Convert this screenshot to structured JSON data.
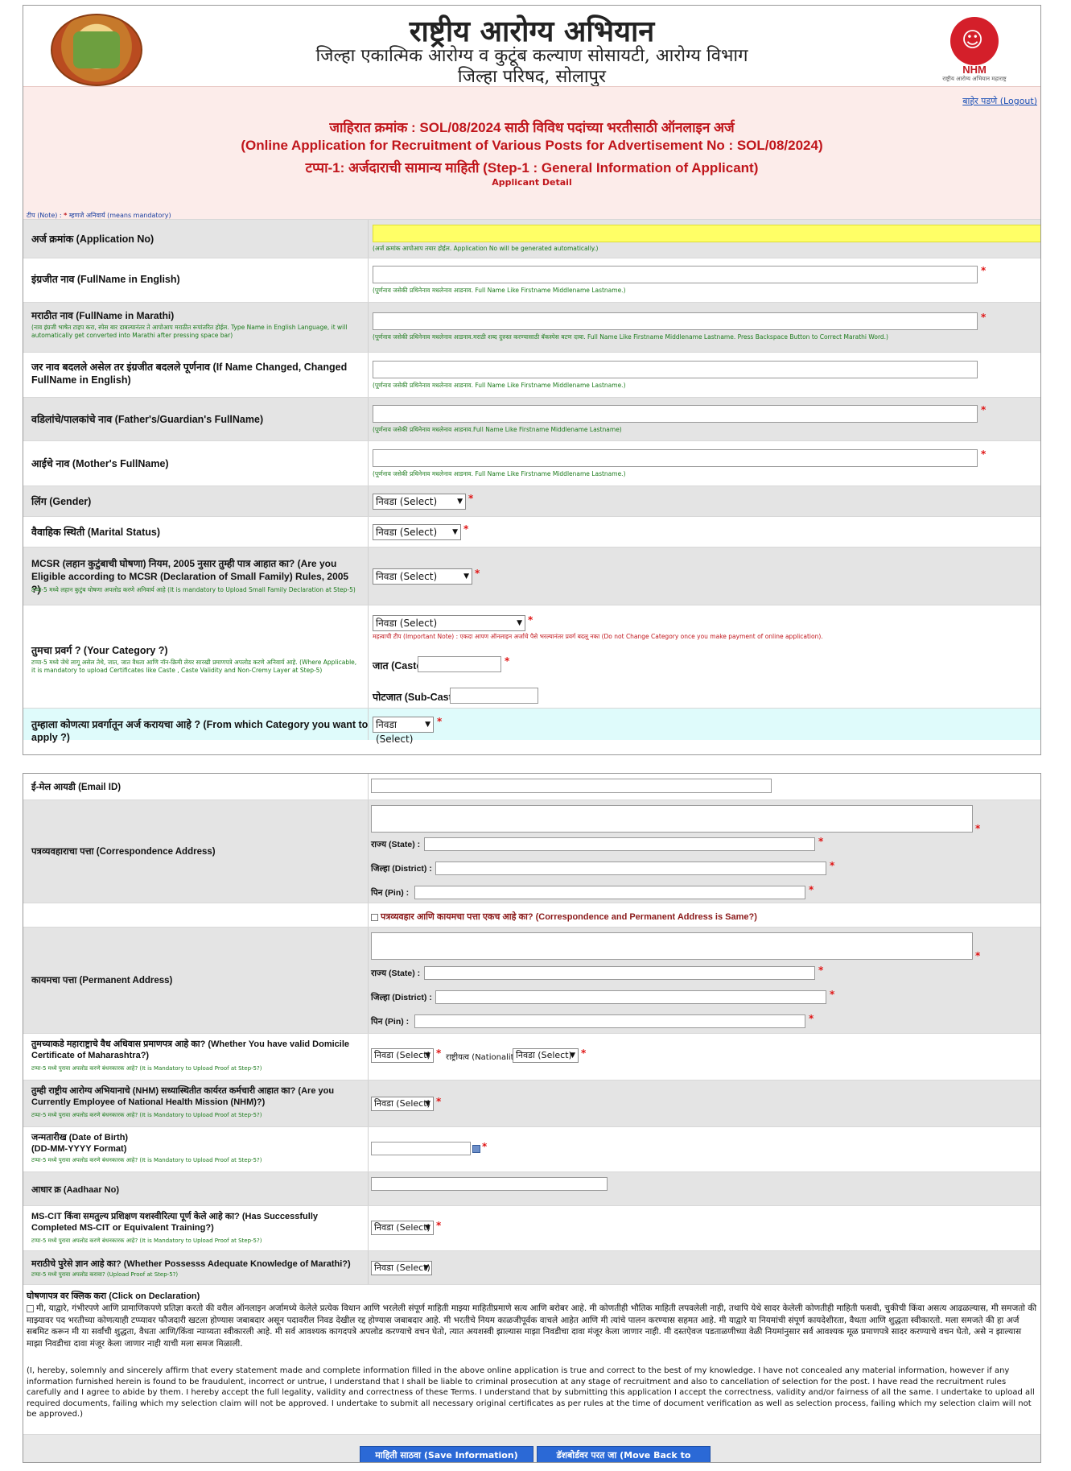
{
  "header": {
    "title": "राष्ट्रीय आरोग्य अभियान",
    "subtitle1": "जिल्हा एकात्मिक आरोग्य व कुटूंब कल्याण सोसायटी, आरोग्य विभाग",
    "subtitle2": "जिल्हा परिषद, सोलापुर",
    "nhm_logo_text": "NHM",
    "nhm_logo_sub": "राष्ट्रीय आरोग्य अभियान महाराष्ट्र",
    "logout_label": "बाहेर पडणे (Logout)"
  },
  "banner": {
    "line1": "जाहिरात क्रमांक : SOL/08/2024 साठी विविध पदांच्या भरतीसाठी ऑनलाइन अर्ज",
    "line2": "(Online Application for Recruitment of Various Posts for Advertisement No : SOL/08/2024)",
    "line3": "टप्पा-1: अर्जदाराची सामान्य माहिती (Step-1 : General Information of Applicant)",
    "line4": "Applicant Detail",
    "note_prefix": "टीप (Note) :",
    "note_star": "*",
    "note_text": "म्हणजे अनिवार्य (means mandatory)"
  },
  "form": {
    "app_no": {
      "label": "अर्ज क्रमांक (Application No)",
      "hint": "(अर्ज क्रमांक आपोआप तयार होईल. Application No will be generated automatically.)"
    },
    "name_en": {
      "label": "इंग्रजीत नाव (FullName in English)",
      "hint": "(पूर्णनाव जसेकी प्रथिनेनाव मधलेनाव आडनाव. Full Name Like Firstname Middlename Lastname.)"
    },
    "name_mr": {
      "label": "मराठीत नाव (FullName in Marathi)",
      "sub": "(नाव इंग्रजी भाषेत टाइप करा, स्पेस बार दाबल्यानंतर ते आपोआप मराठीत रूपांतरित होईल. Type Name in English Language, it will automatically get converted into Marathi after pressing space bar)",
      "hint": "(पूर्णनाव जसेकी प्रथिनेनाव मधलेनाव आडनाव.मराठी शब्द दुरुस्त करण्यासाठी बॅकस्पेस बटण दाबा. Full Name Like Firstname Middlename Lastname. Press Backspace Button to Correct Marathi Word.)"
    },
    "name_changed": {
      "label": "जर नाव बदलले असेल तर इंग्रजीत बदलले पूर्णनाव (If Name Changed, Changed FullName in English)",
      "hint": "(पूर्णनाव जसेकी प्रथिनेनाव मधलेनाव आडनाव. Full Name Like Firstname Middlename Lastname.)"
    },
    "father": {
      "label": "वडिलांचे/पालकांचे नाव (Father's/Guardian's FullName)",
      "hint": "(पूर्णनाव जसेकी प्रथिनेनाव मधलेनाव आडनाव.Full Name Like Firstname Middlename Lastname)"
    },
    "mother": {
      "label": "आईचे नाव (Mother's FullName)",
      "hint": "(पूर्णनाव जसेकी प्रथिनेनाव मधलेनाव आडनाव. Full Name Like Firstname Middlename Lastname.)"
    },
    "gender": {
      "label": "लिंग (Gender)",
      "value": "निवडा (Select)"
    },
    "marital": {
      "label": "वैवाहिक स्थिती (Marital Status)",
      "value": "निवडा (Select)"
    },
    "mcsr": {
      "label": "MCSR (लहान कुटुंबाची घोषणा) नियम, 2005 नुसार तुम्ही पात्र आहात का? (Are you Eligible according to MCSR (Declaration of Small Family) Rules, 2005 ?)",
      "sub": "टप्पा-5 मध्ये लहान कुटुंब घोषणा अपलोड करणे अनिवार्य आहे (It is mandatory to Upload Small Family Declaration at Step-5)",
      "value": "निवडा (Select)"
    },
    "category": {
      "label": "तुमचा प्रवर्ग ? (Your Category ?)",
      "sub": "टप्पा-5 मध्ये जेथे लागू असेल तेथे, जात, जात वैधता आणि नॉन-क्रिमी लेयर सारखी प्रमाणपत्रे अपलोड करणे अनिवार्य आहे. (Where Applicable, it is mandatory to upload Certificates like Caste , Caste Validity and Non-Cremy Layer at Step-5)",
      "value": "निवडा (Select)",
      "important": "महत्वाची टीप (Important Note) : एकदा आपण ऑनलाइन अर्जाचे पैसे भरल्यानंतर प्रवर्ग बदलू नका (Do not Change Category once you make payment of online application).",
      "caste_label": "जात (Caste)",
      "subcaste_label": "पोटजात (Sub-Caste)"
    },
    "apply_category": {
      "label": "तुम्हाला कोणत्या प्रवर्गातून अर्ज करायचा आहे ? (From which Category you want to apply ?)",
      "value": "निवडा (Select)"
    },
    "email": {
      "label": "ई-मेल आयडी (Email ID)"
    },
    "corr_address": {
      "label": "पत्रव्यवहाराचा पत्ता (Correspondence Address)",
      "state": "राज्य (State) :",
      "district": "जिल्हा (District) :",
      "pin": "पिन (Pin) :"
    },
    "same_address": {
      "label": "पत्रव्यवहार आणि कायमचा पत्ता एकच आहे का? (Correspondence and Permanent Address is Same?)"
    },
    "perm_address": {
      "label": "कायमचा पत्ता (Permanent Address)",
      "state": "राज्य (State) :",
      "district": "जिल्हा (District) :",
      "pin": "पिन (Pin) :"
    },
    "domicile": {
      "label": "तुमच्याकडे महाराष्ट्राचे वैध अधिवास प्रमाणपत्र आहे का? (Whether You have valid Domicile Certificate of Maharashtra?)",
      "sub": "टप्पा-5 मध्ये पुरावा अपलोड करणे बंधनकारक आहे? (It is Mandatory to Upload Proof at Step-5?)",
      "value": "निवडा (Select)",
      "nationality_label": "राष्ट्रीयत्व (Nationality)",
      "nationality_value": "निवडा (Select)"
    },
    "nhm_employee": {
      "label": "तुम्ही राष्ट्रीय आरोग्य अभियानाचे (NHM) सध्यास्थितीत कार्यरत कर्मचारी आहात का? (Are you Currently Employee of National Health Mission (NHM)?)",
      "sub": "टप्पा-5 मध्ये पुरावा अपलोड करणे बंधनकारक आहे? (It is Mandatory to Upload Proof at Step-5?)",
      "value": "निवडा (Select)"
    },
    "dob": {
      "label": "जन्मतारीख (Date of Birth)",
      "label2": "(DD-MM-YYYY Format)",
      "sub": "टप्पा-5 मध्ये पुरावा अपलोड करणे बंधनकारक आहे? (It is Mandatory to Upload Proof at Step-5?)"
    },
    "aadhaar": {
      "label": "आधार क्र (Aadhaar No)"
    },
    "mscit": {
      "label": "MS-CIT किंवा समतुल्य प्रशिक्षण यशस्वीरित्या पूर्ण केले आहे का? (Has Successfully Completed MS-CIT or Equivalent Training?)",
      "sub": "टप्पा-5 मध्ये पुरावा अपलोड करणे बंधनकारक आहे? (It is Mandatory to Upload Proof at Step-5?)",
      "value": "निवडा (Select)"
    },
    "marathi": {
      "label": "मराठीचे पुरेसे ज्ञान आहे का? (Whether Possesss Adequate Knowledge of Marathi?)",
      "sub": "टप्पा-5 मध्ये पुरावा अपलोड करावा? (Upload Proof at Step-5?)",
      "value": "निवडा (Select)"
    }
  },
  "declaration": {
    "title": "घोषणापत्र वर क्लिक करा (Click on Declaration)",
    "marathi": "मी, याद्वारे, गंभीरपणे आणि प्रामाणिकपणे प्रतिज्ञा करतो की वरील ऑनलाइन अर्जामध्ये केलेले प्रत्येक विधान आणि भरलेली संपूर्ण माहिती माझ्या माहितीप्रमाणे सत्य आणि बरोबर आहे. मी कोणतीही भौतिक माहिती लपवलेली नाही, तथापि येथे सादर केलेली कोणतीही माहिती फसवी, चुकीची किंवा असत्य आढळल्यास, मी समजतो की माझ्यावर पद भरतीच्या कोणत्याही टप्प्यावर फौजदारी खटला होण्यास जबाबदार असून पदावरील निवड देखील रद्द होण्यास जबाबदार आहे. मी भरतीचे नियम काळजीपूर्वक वाचले आहेत आणि मी त्यांचे पालन करण्यास सहमत आहे. मी याद्वारे या नियमांची संपूर्ण कायदेशीरता, वैधता आणि शुद्धता स्वीकारतो. मला समजते की हा अर्ज सबमिट करून मी या सर्वांची शुद्धता, वैधता आणि/किंवा न्याय्यता स्वीकारली आहे. मी सर्व आवश्यक कागदपत्रे अपलोड करण्याचे वचन घेतो, त्यात अयशस्वी झाल्यास माझा निवडीचा दावा मंजूर केला जाणार नाही. मी दस्तऐवज पडताळणीच्या वेळी नियमांनुसार सर्व आवश्यक मूळ प्रमाणपत्रे सादर करण्याचे वचन घेतो, असे न झाल्यास माझा निवडीचा दावा मंजूर केला जाणार नाही याची मला समज मिळाली.",
    "english": "(I, hereby, solemnly and sincerely affirm that every statement made and complete information filled in the above online application is true and correct to the best of my knowledge. I have not concealed any material information, however if any information furnished herein is found to be fraudulent, incorrect or untrue, I understand that I shall be liable to criminal prosecution at any stage of recruitment and also to cancellation of selection for the post. I have read the recruitment rules carefully and I agree to abide by them. I hereby accept the full legality, validity and correctness of these Terms. I understand that by submitting this application I accept the correctness, validity and/or fairness of all the same. I undertake to upload all required documents, failing which my selection claim will not be approved. I undertake to submit all necessary original certificates as per rules at the time of document verification as well as selection process, failing which my selection claim will not be approved.)"
  },
  "buttons": {
    "save": "माहिती साठवा (Save Information)",
    "dashboard": "डॅशबोर्डवर परत जा (Move Back to Dashboard)"
  },
  "colors": {
    "banner_bg": "#fcecea",
    "banner_text": "#c0151b",
    "button": "#2b69d6",
    "hint_green": "#1b7a1b",
    "mandatory": "#e01515",
    "appno_field": "#ffff66"
  }
}
